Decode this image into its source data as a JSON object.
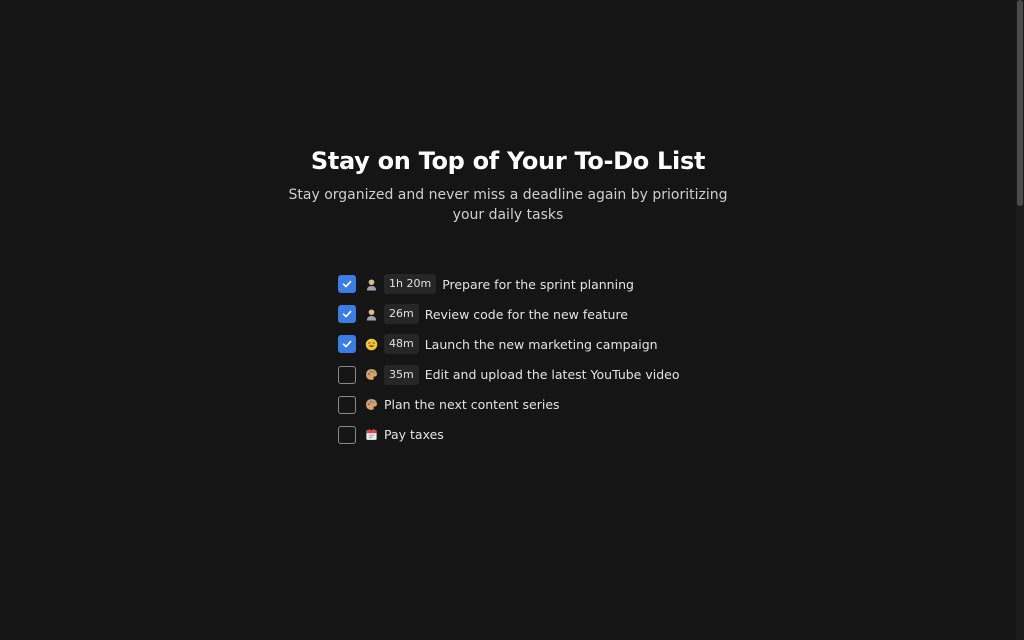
{
  "hero": {
    "title": "Stay on Top of Your To-Do List",
    "subtitle": "Stay organized and never miss a deadline again by prioritizing your daily tasks"
  },
  "colors": {
    "background": "#151515",
    "checkbox_checked": "#3d7de0",
    "duration_badge": "#262626"
  },
  "tasks": [
    {
      "checked": true,
      "icon": "person-icon",
      "duration": "1h 20m",
      "label": "Prepare for the sprint planning"
    },
    {
      "checked": true,
      "icon": "person-icon",
      "duration": "26m",
      "label": "Review code for the new feature"
    },
    {
      "checked": true,
      "icon": "grin-icon",
      "duration": "48m",
      "label": "Launch the new marketing campaign"
    },
    {
      "checked": false,
      "icon": "palette-icon",
      "duration": "35m",
      "label": "Edit and upload the latest YouTube video"
    },
    {
      "checked": false,
      "icon": "palette-icon",
      "duration": "",
      "label": "Plan the next content series"
    },
    {
      "checked": false,
      "icon": "calendar-icon",
      "duration": "",
      "label": "Pay taxes"
    }
  ]
}
